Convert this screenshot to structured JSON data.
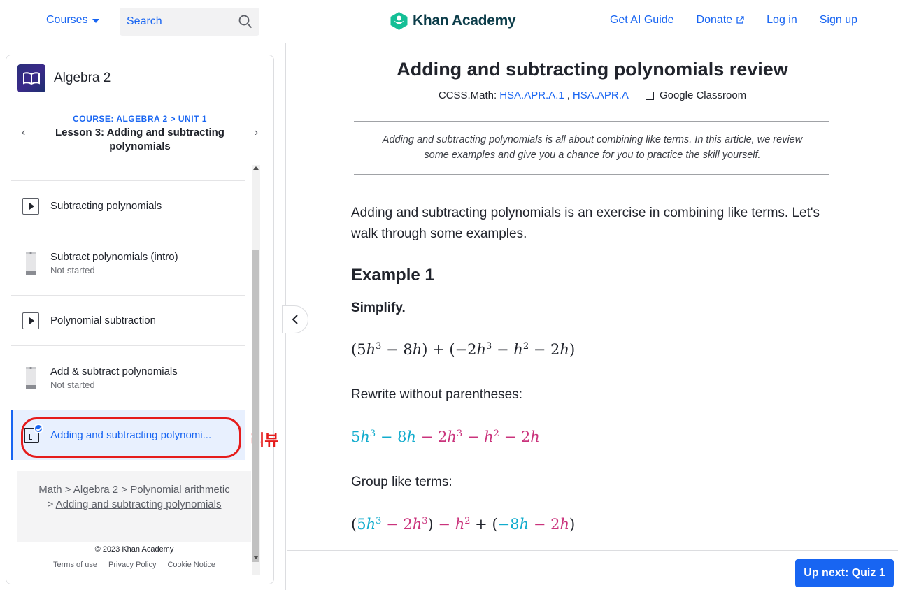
{
  "header": {
    "courses_label": "Courses",
    "search_placeholder": "Search",
    "logo_text": "Khan Academy",
    "nav": [
      "Get AI Guide",
      "Donate",
      "Log in",
      "Sign up"
    ]
  },
  "sidebar": {
    "course_title": "Algebra 2",
    "lesson_crumb": "COURSE: ALGEBRA 2 > UNIT 1",
    "lesson_title": "Lesson 3: Adding and subtracting polynomials",
    "items": [
      {
        "title": "Subtracting polynomials",
        "kind": "video",
        "status": ""
      },
      {
        "title": "Subtract polynomials (intro)",
        "kind": "exercise",
        "status": "Not started"
      },
      {
        "title": "Polynomial subtraction",
        "kind": "video",
        "status": ""
      },
      {
        "title": "Add & subtract polynomials",
        "kind": "exercise",
        "status": "Not started"
      },
      {
        "title": "Adding and subtracting polynomi...",
        "kind": "article",
        "status": "",
        "active": true
      }
    ],
    "annotation": "리뷰",
    "breadcrumbs": [
      "Math",
      "Algebra 2",
      "Polynomial arithmetic",
      "Adding and subtracting polynomials"
    ],
    "copyright": "© 2023 Khan Academy",
    "footer_links": [
      "Terms of use",
      "Privacy Policy",
      "Cookie Notice"
    ]
  },
  "article": {
    "title": "Adding and subtracting polynomials review",
    "standards_prefix": "CCSS.Math:",
    "standard_1": "HSA.APR.A.1",
    "standard_2": "HSA.APR.A",
    "google_classroom": "Google Classroom",
    "intro": "Adding and subtracting polynomials is all about combining like terms. In this article, we review some examples and give you a chance for you to practice the skill yourself.",
    "body": "Adding and subtracting polynomials is an exercise in combining like terms. Let's walk through some examples.",
    "example_heading": "Example 1",
    "simplify": "Simplify.",
    "rewrite_label": "Rewrite without parentheses:",
    "group_label": "Group like terms:"
  },
  "next_button": "Up next: Quiz 1",
  "colors": {
    "accent": "#1865f2",
    "math_blue": "#11accd",
    "math_red": "#ca337c",
    "annotation": "#e51c1c"
  }
}
